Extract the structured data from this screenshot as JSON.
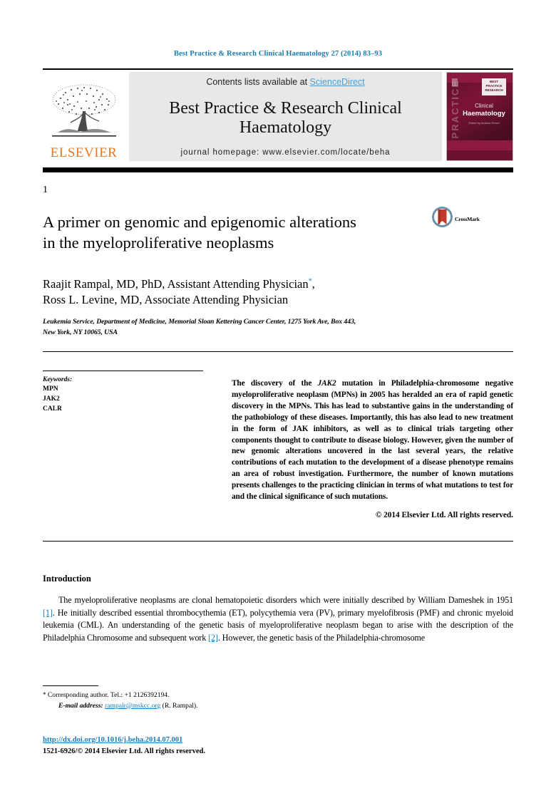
{
  "running_head": "Best Practice & Research Clinical Haematology 27 (2014) 83–93",
  "masthead": {
    "contents_prefix": "Contents lists available at ",
    "sciencedirect": "ScienceDirect",
    "journal_title_line1": "Best Practice & Research Clinical",
    "journal_title_line2": "Haematology",
    "homepage": "journal homepage: www.elsevier.com/locate/beha",
    "publisher_name": "ELSEVIER",
    "publisher_logo_icon": "elsevier-tree-icon",
    "cover": {
      "vertical_text": "PRACTICE",
      "badge_text": "BEST PRACTICE RESEARCH",
      "title_small": "Clinical",
      "title_large": "Haematology",
      "subtitle": "Edited by\nAndrew Renwi"
    },
    "accent_link_color": "#4a9fd4",
    "brand_orange": "#E87722",
    "cover_maroon": "#5d0f2c"
  },
  "article": {
    "number": "1",
    "title_line1": "A primer on genomic and epigenomic alterations",
    "title_line2": "in the myeloproliferative neoplasms",
    "crossmark_label": "CrossMark",
    "crossmark_icon": "crossmark-icon",
    "author_line1": "Raajit Rampal, MD, PhD, Assistant Attending Physician",
    "author_line1_marker": "*",
    "author_line1_comma": ",",
    "author_line2": "Ross L. Levine, MD, Associate Attending Physician",
    "affiliation_line1": "Leukemia Service, Department of Medicine, Memorial Sloan Kettering Cancer Center, 1275 York Ave, Box 443,",
    "affiliation_line2": "New York, NY 10065, USA"
  },
  "keywords": {
    "heading": "Keywords:",
    "items": [
      "MPN",
      "JAK2",
      "CALR"
    ]
  },
  "abstract": {
    "text_part1": "The discovery of the ",
    "italic1": "JAK2",
    "text_part2": " mutation in Philadelphia-chromosome negative myeloproliferative neoplasm (MPNs) in 2005 has heralded an era of rapid genetic discovery in the MPNs. This has lead to substantive gains in the understanding of the pathobiology of these diseases. Importantly, this has also lead to new treatment in the form of JAK inhibitors, as well as to clinical trials targeting other components thought to contribute to disease biology. However, given the number of new genomic alterations uncovered in the last several years, the relative contributions of each mutation to the development of a disease phenotype remains an area of robust investigation. Furthermore, the number of known mutations presents challenges to the practicing clinician in terms of what mutations to test for and the clinical significance of such mutations.",
    "copyright": "© 2014 Elsevier Ltd. All rights reserved."
  },
  "body": {
    "section_heading": "Introduction",
    "paragraph_a": "The myeloproliferative neoplasms are clonal hematopoietic disorders which were initially described by William Dameshek in 1951 ",
    "ref1": "[1]",
    "paragraph_b": ". He initially described essential thrombocythemia (ET), polycythemia vera (PV), primary myelofibrosis (PMF) and chronic myeloid leukemia (CML). An understanding of the genetic basis of myeloproliferative neoplasm began to arise with the description of the Philadelphia Chromosome and subsequent work ",
    "ref2": "[2]",
    "paragraph_c": ". However, the genetic basis of the Philadelphia-chromosome"
  },
  "footnote": {
    "star": "*",
    "corresponding": "Corresponding author. Tel.: +1 2126392194.",
    "email_label": "E-mail address:",
    "email": "rampalr@mskcc.org",
    "email_attrib": "(R. Rampal)."
  },
  "footer": {
    "doi": "http://dx.doi.org/10.1016/j.beha.2014.07.001",
    "issn_line": "1521-6926/© 2014 Elsevier Ltd. All rights reserved."
  }
}
